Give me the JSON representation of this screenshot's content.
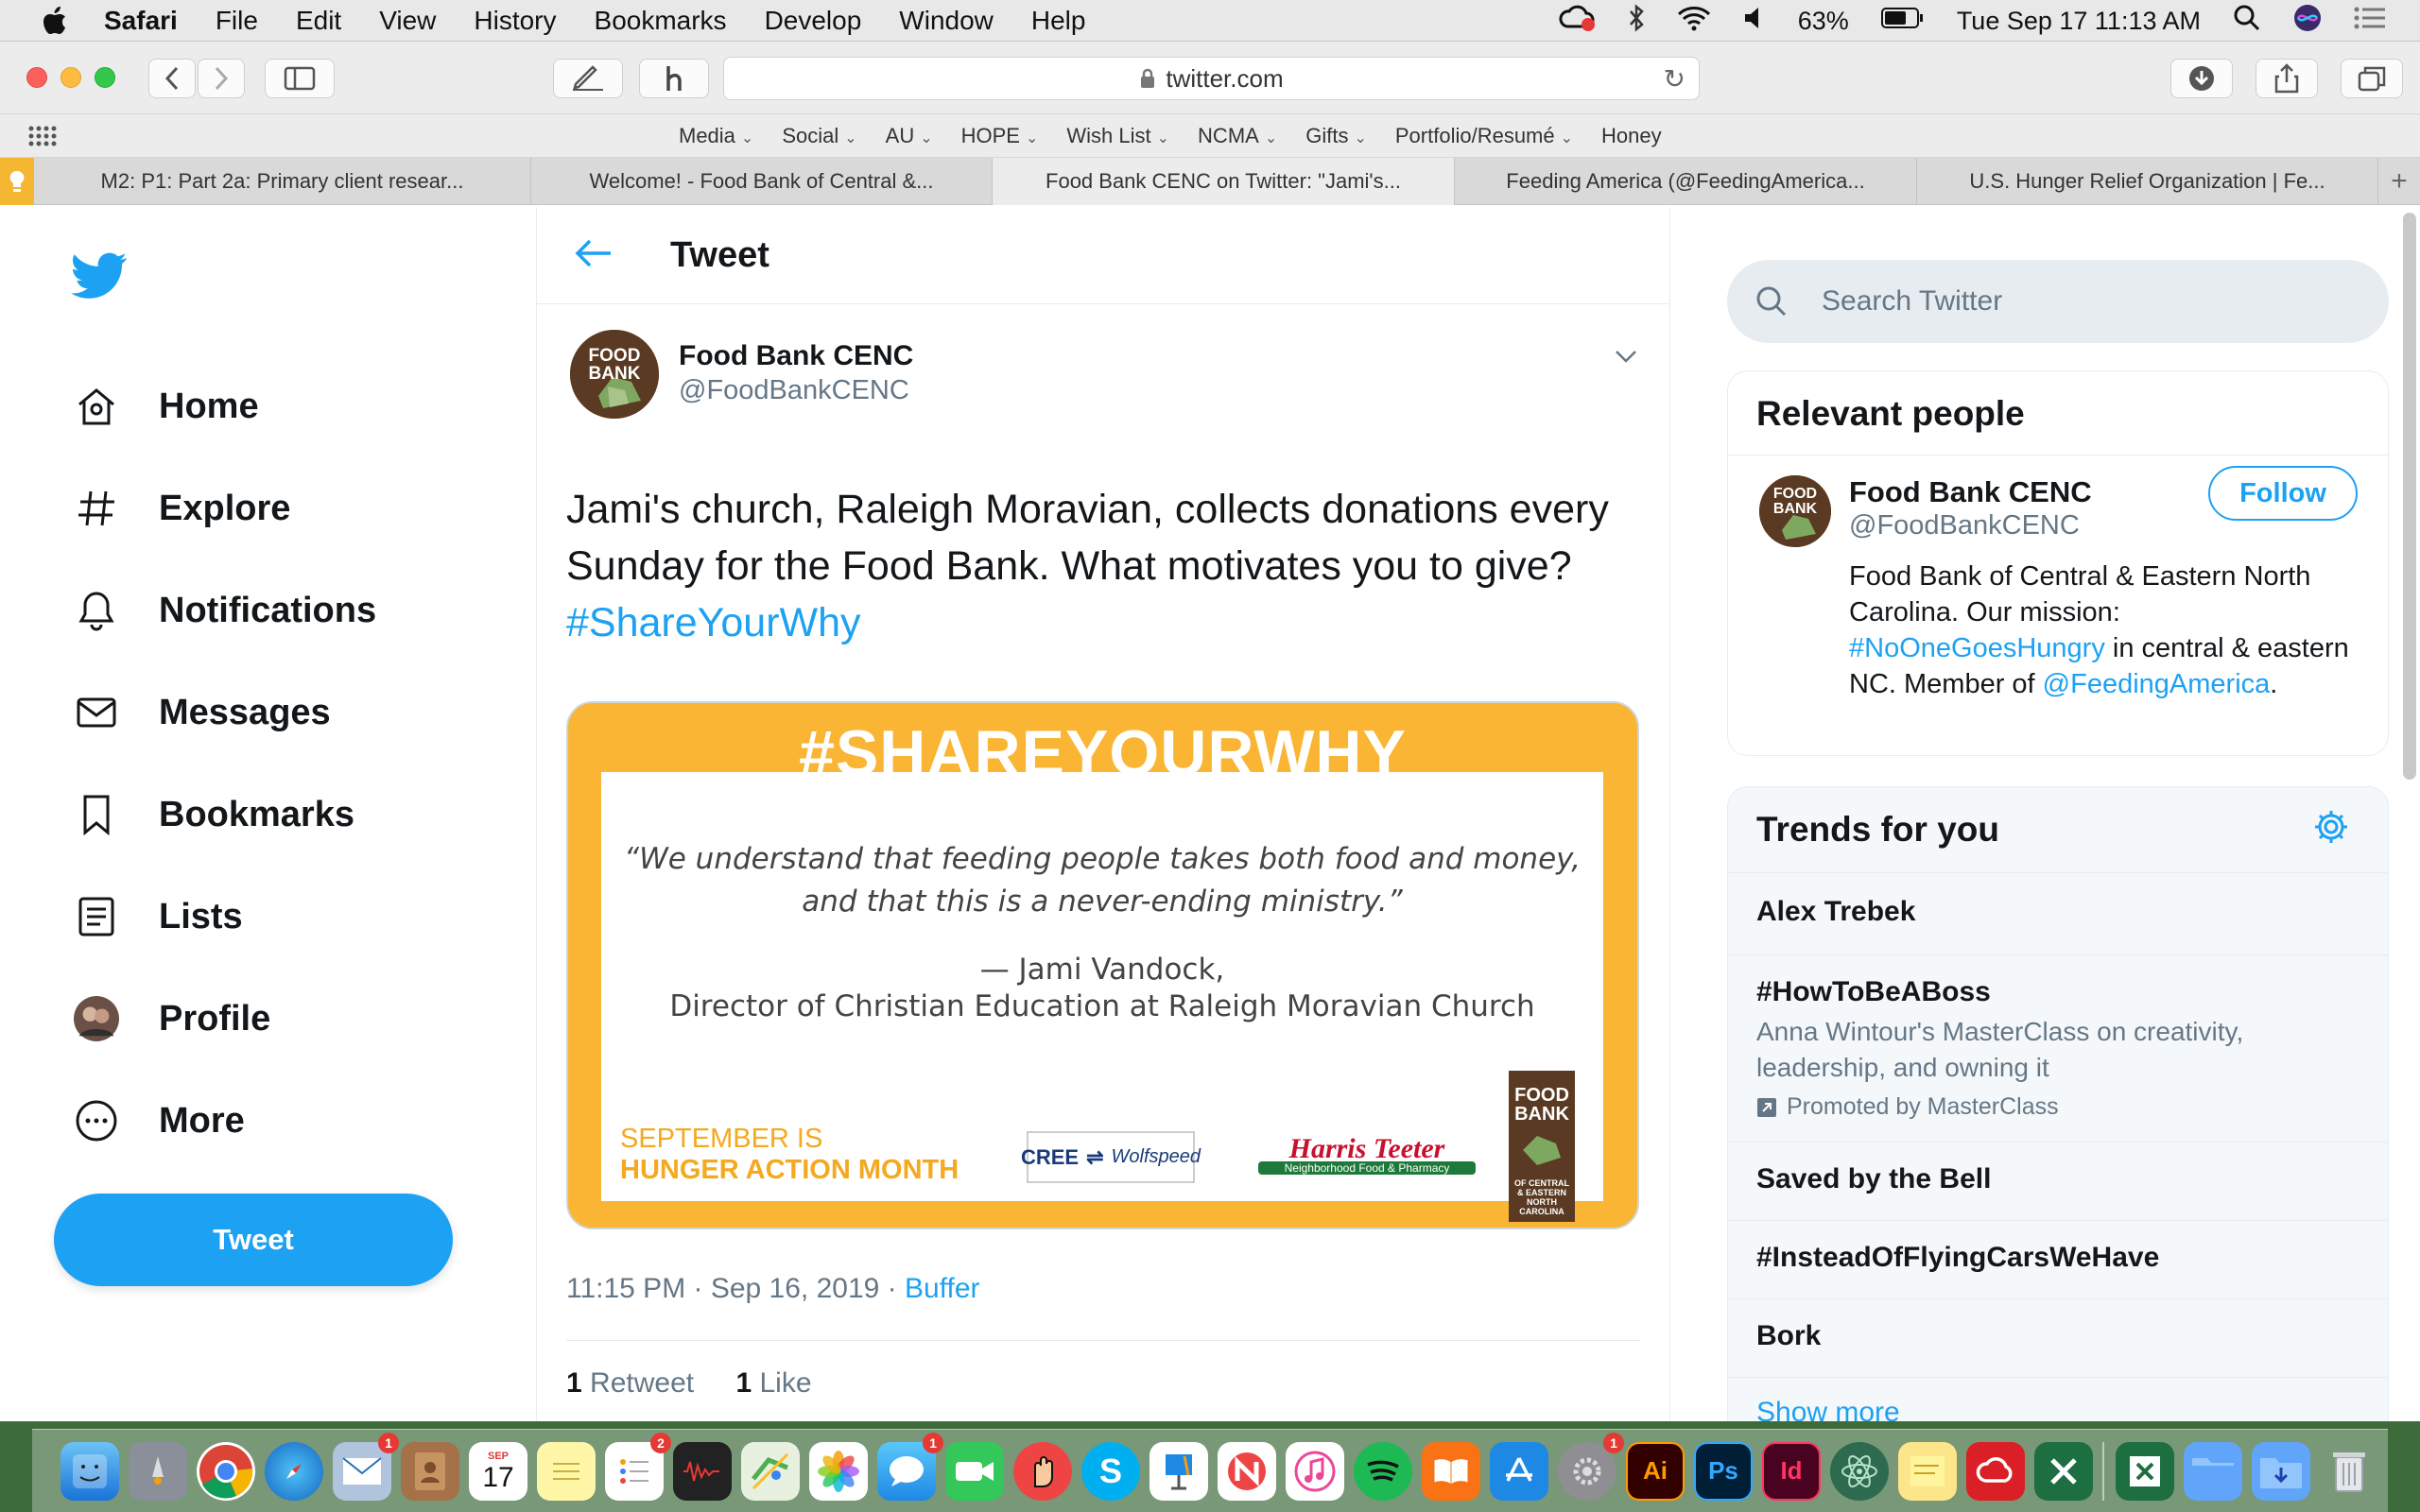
{
  "menubar": {
    "app": "Safari",
    "items": [
      "File",
      "Edit",
      "View",
      "History",
      "Bookmarks",
      "Develop",
      "Window",
      "Help"
    ],
    "battery": "63%",
    "datetime": "Tue Sep 17  11:13 AM"
  },
  "toolbar": {
    "url": "twitter.com"
  },
  "favorites": [
    {
      "label": "Media",
      "chevron": true
    },
    {
      "label": "Social",
      "chevron": true
    },
    {
      "label": "AU",
      "chevron": true
    },
    {
      "label": "HOPE",
      "chevron": true
    },
    {
      "label": "Wish List",
      "chevron": true
    },
    {
      "label": "NCMA",
      "chevron": true
    },
    {
      "label": "Gifts",
      "chevron": true
    },
    {
      "label": "Portfolio/Resumé",
      "chevron": true
    },
    {
      "label": "Honey",
      "chevron": false
    }
  ],
  "tabs": [
    {
      "label": "M2: P1: Part 2a: Primary client resear...",
      "active": false
    },
    {
      "label": "Welcome! - Food Bank of Central &...",
      "active": false
    },
    {
      "label": "Food Bank CENC on Twitter: \"Jami's...",
      "active": true
    },
    {
      "label": "Feeding America (@FeedingAmerica...",
      "active": false
    },
    {
      "label": "U.S. Hunger Relief Organization | Fe...",
      "active": false
    }
  ],
  "nav": {
    "home": "Home",
    "explore": "Explore",
    "notifications": "Notifications",
    "messages": "Messages",
    "bookmarks": "Bookmarks",
    "lists": "Lists",
    "profile": "Profile",
    "more": "More",
    "tweet_button": "Tweet"
  },
  "center": {
    "title": "Tweet",
    "author_name": "Food Bank CENC",
    "author_handle": "@FoodBankCENC",
    "avatar_text": "FOOD BANK",
    "text": "Jami's church, Raleigh Moravian, collects donations every Sunday for the Food Bank.  What motivates you to give?  ",
    "hashtag": "#ShareYourWhy",
    "card": {
      "header": "#SHAREYOURWHY",
      "quote_line1": "“We understand that feeding people takes both food and money,",
      "quote_line2": "and that this is a never-ending ministry.”",
      "attrib_line1": "— Jami Vandock,",
      "attrib_line2": "Director of Christian Education at Raleigh Moravian Church",
      "september_line1": "SEPTEMBER IS",
      "september_line2": "HUNGER ACTION MONTH",
      "sponsor1_a": "CREE",
      "sponsor1_b": "Wolfspeed",
      "sponsor2": "Harris Teeter",
      "sponsor2_sub": "Neighborhood Food & Pharmacy",
      "logo_text": "FOOD BANK",
      "logo_sub": "OF CENTRAL & EASTERN NORTH CAROLINA"
    },
    "time": "11:15 PM · Sep 16, 2019 · ",
    "source": "Buffer",
    "retweets_count": "1",
    "retweets_label": "Retweet",
    "likes_count": "1",
    "likes_label": "Like"
  },
  "search": {
    "placeholder": "Search Twitter"
  },
  "relevant": {
    "title": "Relevant people",
    "name": "Food Bank CENC",
    "handle": "@FoodBankCENC",
    "follow": "Follow",
    "bio_1": "Food Bank of Central & Eastern North Carolina. Our mission: ",
    "bio_tag": "#NoOneGoesHungry",
    "bio_2": " in central & eastern NC. Member of ",
    "bio_mention": "@FeedingAmerica",
    "bio_3": "."
  },
  "trends": {
    "title": "Trends for you",
    "items": [
      {
        "name": "Alex Trebek"
      },
      {
        "name": "#HowToBeABoss",
        "desc": "Anna Wintour's MasterClass on creativity, leadership, and owning it",
        "promoted": "Promoted by MasterClass"
      },
      {
        "name": "Saved by the Bell"
      },
      {
        "name": "#InsteadOfFlyingCarsWeHave"
      },
      {
        "name": "Bork"
      }
    ],
    "show_more": "Show more"
  },
  "dock": {
    "calendar_month": "SEP",
    "calendar_day": "17",
    "badge_mail": "1",
    "badge_reminders": "2",
    "badge_messages": "1",
    "badge_sysprefs": "1",
    "illustrator": "Ai",
    "photoshop": "Ps",
    "indesign": "Id"
  },
  "colors": {
    "twitter_blue": "#1da1f2",
    "card_orange": "#f9b533",
    "text_dark": "#14171a",
    "text_gray": "#657786"
  }
}
